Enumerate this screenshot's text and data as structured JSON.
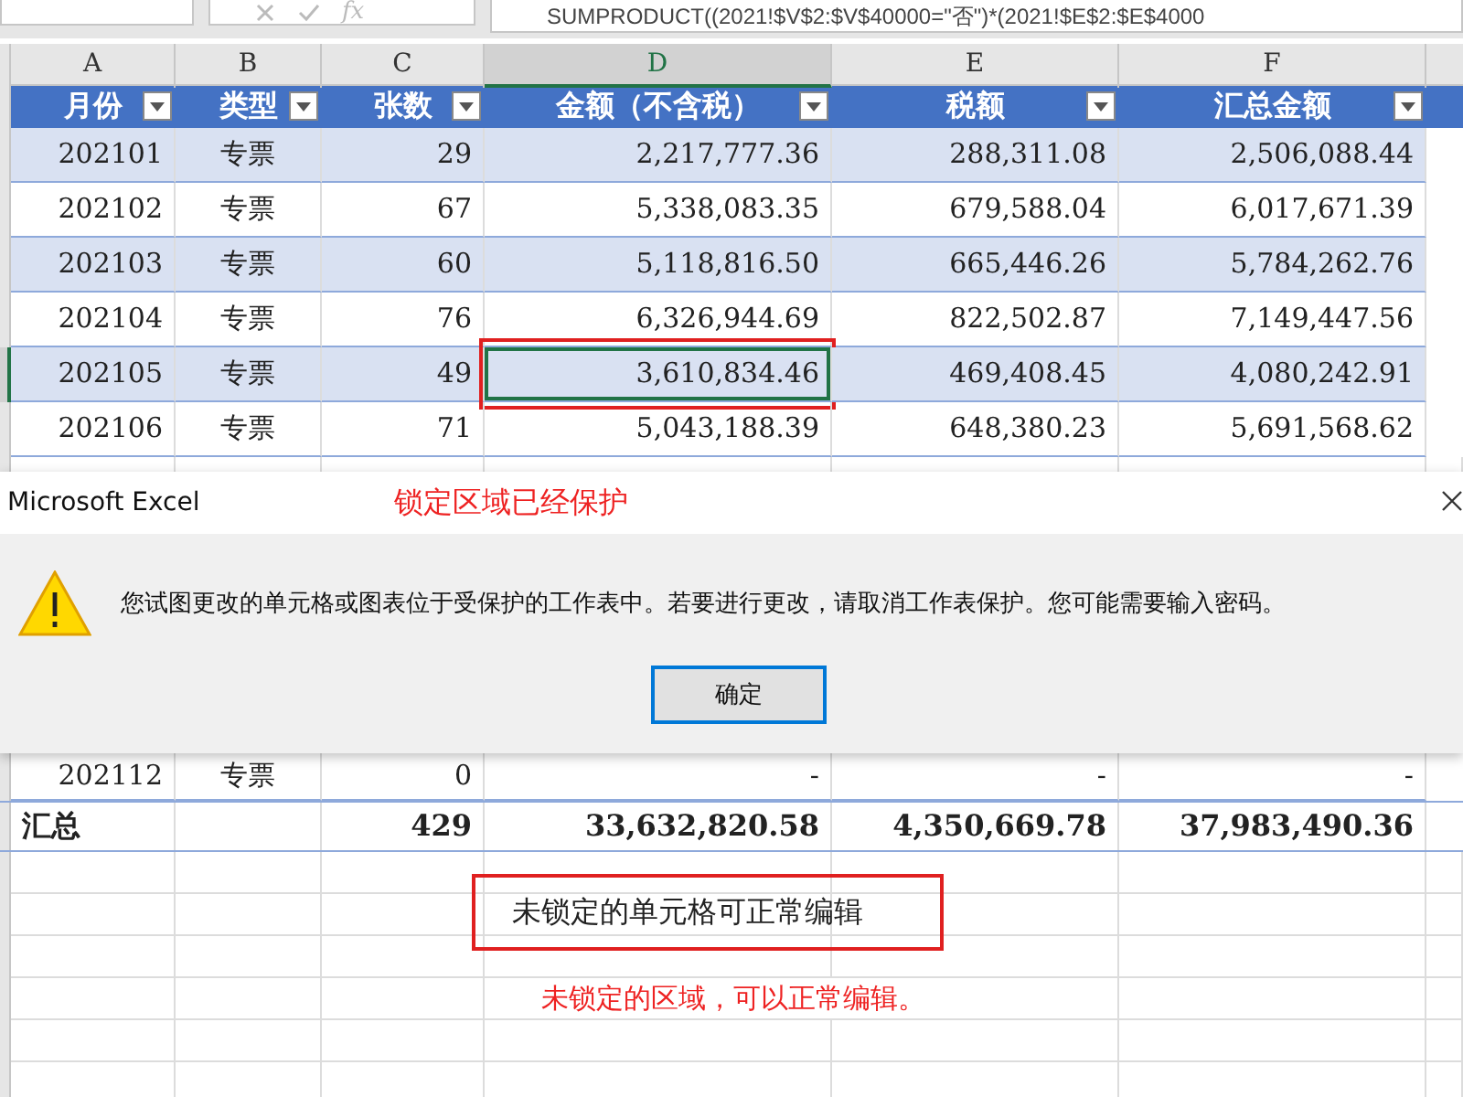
{
  "formula_bar": {
    "fx_label": "fx",
    "formula": "SUMPRODUCT((2021!$V$2:$V$40000=\"否\")*(2021!$E$2:$E$4000"
  },
  "columns": [
    {
      "letter": "A",
      "selected": false
    },
    {
      "letter": "B",
      "selected": false
    },
    {
      "letter": "C",
      "selected": false
    },
    {
      "letter": "D",
      "selected": true
    },
    {
      "letter": "E",
      "selected": false
    },
    {
      "letter": "F",
      "selected": false
    }
  ],
  "table": {
    "headers": [
      "月份",
      "类型",
      "张数",
      "金额（不含税）",
      "税额",
      "汇总金额"
    ],
    "rows": [
      {
        "cells": [
          "202101",
          "专票",
          "29",
          "2,217,777.36",
          "288,311.08",
          "2,506,088.44"
        ],
        "selected": false
      },
      {
        "cells": [
          "202102",
          "专票",
          "67",
          "5,338,083.35",
          "679,588.04",
          "6,017,671.39"
        ],
        "selected": false
      },
      {
        "cells": [
          "202103",
          "专票",
          "60",
          "5,118,816.50",
          "665,446.26",
          "5,784,262.76"
        ],
        "selected": false
      },
      {
        "cells": [
          "202104",
          "专票",
          "76",
          "6,326,944.69",
          "822,502.87",
          "7,149,447.56"
        ],
        "selected": false
      },
      {
        "cells": [
          "202105",
          "专票",
          "49",
          "3,610,834.46",
          "469,408.45",
          "4,080,242.91"
        ],
        "selected": true
      },
      {
        "cells": [
          "202106",
          "专票",
          "71",
          "5,043,188.39",
          "648,380.23",
          "5,691,568.62"
        ],
        "selected": false
      }
    ],
    "lower_rows": [
      {
        "cells": [
          "202112",
          "专票",
          "0",
          "-",
          "-",
          "-"
        ],
        "selected": false
      }
    ],
    "total": {
      "label": "汇总",
      "cells": [
        "429",
        "33,632,820.58",
        "4,350,669.78",
        "37,983,490.36"
      ]
    }
  },
  "dialog": {
    "title": "Microsoft Excel",
    "annotation": "锁定区域已经保护",
    "message": "您试图更改的单元格或图表位于受保护的工作表中。若要进行更改，请取消工作表保护。您可能需要输入密码。",
    "button": "确定"
  },
  "unlocked_cell_text": "未锁定的单元格可正常编辑",
  "note": "未锁定的区域，可以正常编辑。"
}
